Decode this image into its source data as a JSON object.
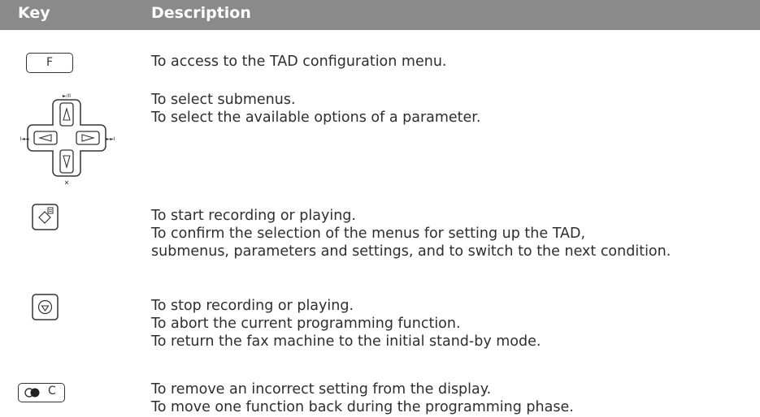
{
  "table": {
    "header": {
      "key": "Key",
      "description": "Description"
    },
    "rows": [
      {
        "key_icon": "f-key",
        "key_label": "F",
        "lines": [
          "To access to the TAD configuration menu."
        ]
      },
      {
        "key_icon": "navigation-cross-keys",
        "symbols": {
          "up": "►/II",
          "left": "I◄◄",
          "right": "►►I",
          "down": "✕"
        },
        "lines": [
          "To select submenus.",
          "To select the available options of a parameter."
        ]
      },
      {
        "key_icon": "start-copy-key",
        "lines": [
          "To start recording or playing.",
          "To confirm the selection of the menus for setting up the TAD,",
          "submenus, parameters and settings, and to switch to the next condition."
        ]
      },
      {
        "key_icon": "stop-key",
        "lines": [
          "To stop recording or playing.",
          "To abort the current programming function.",
          "To return the fax machine to the initial stand-by mode."
        ]
      },
      {
        "key_icon": "clear-c-key",
        "key_label": "C",
        "lines": [
          "To remove an incorrect setting from the display.",
          "To move one function back during the programming phase."
        ]
      }
    ]
  }
}
